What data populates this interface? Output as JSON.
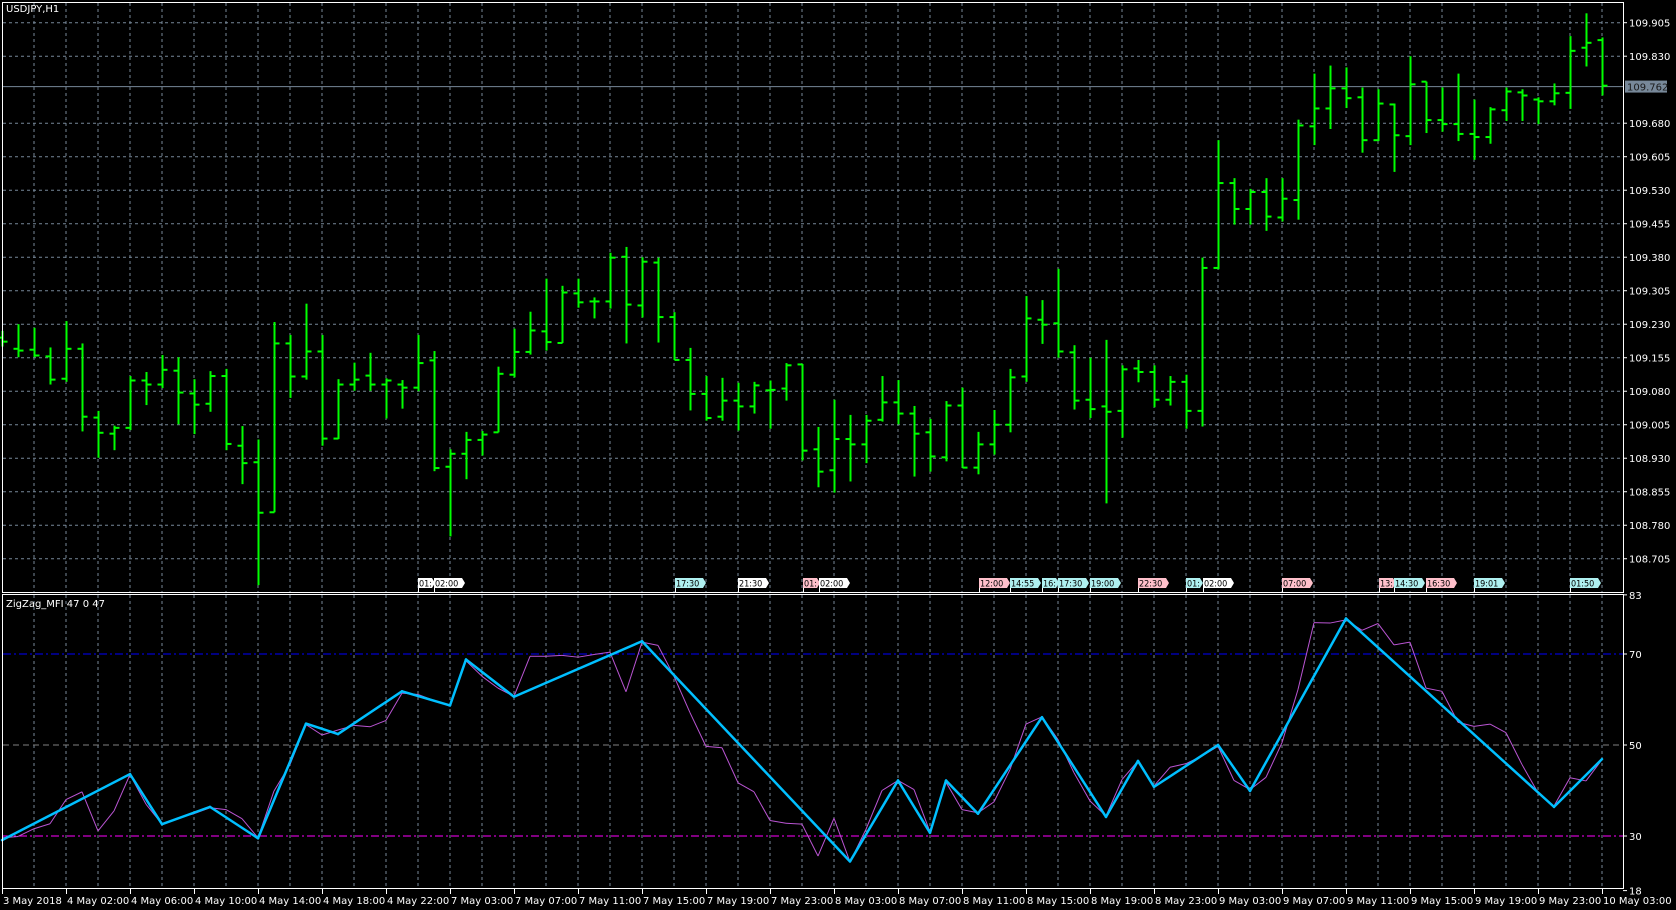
{
  "window": {
    "symbol_title": "USDJPY,H1",
    "indicator_title": "ZigZag_MFI 47 0 47"
  },
  "colors": {
    "background": "#000000",
    "bars": "#00ff00",
    "grid": "#778899",
    "axis": "#ffffff",
    "zigzag": "#00bfff",
    "mfi": "#ba55d3",
    "level_high": "#0000ff",
    "level_mid": "#808080",
    "level_low": "#ff00ff",
    "current_price_badge": "#778899"
  },
  "price_axis": {
    "labels": [
      "109.905",
      "109.830",
      "109.680",
      "109.605",
      "109.530",
      "109.455",
      "109.380",
      "109.305",
      "109.230",
      "109.155",
      "109.080",
      "109.005",
      "108.930",
      "108.855",
      "108.780",
      "108.705"
    ],
    "current_price": "109.762"
  },
  "indicator_axis": {
    "labels": [
      "83",
      "70",
      "50",
      "30",
      "18"
    ],
    "levels": [
      70,
      50,
      30
    ],
    "range": [
      18,
      83
    ]
  },
  "time_axis": {
    "labels": [
      "3 May 2018",
      "4 May 02:00",
      "4 May 06:00",
      "4 May 10:00",
      "4 May 14:00",
      "4 May 18:00",
      "4 May 22:00",
      "7 May 03:00",
      "7 May 07:00",
      "7 May 11:00",
      "7 May 15:00",
      "7 May 19:00",
      "7 May 23:00",
      "8 May 03:00",
      "8 May 07:00",
      "8 May 11:00",
      "8 May 15:00",
      "8 May 19:00",
      "8 May 23:00",
      "9 May 03:00",
      "9 May 07:00",
      "9 May 11:00",
      "9 May 15:00",
      "9 May 19:00",
      "9 May 23:00",
      "10 May 03:00"
    ]
  },
  "events": [
    {
      "label": "01:",
      "type": "neutral"
    },
    {
      "label": "02:00",
      "type": "neutral"
    },
    {
      "label": "17:30",
      "type": "low"
    },
    {
      "label": "21:30",
      "type": "neutral"
    },
    {
      "label": "01:",
      "type": "high"
    },
    {
      "label": "02:00",
      "type": "neutral"
    },
    {
      "label": "12:00",
      "type": "high"
    },
    {
      "label": "14:55",
      "type": "low"
    },
    {
      "label": "16:",
      "type": "low"
    },
    {
      "label": "17:30",
      "type": "low"
    },
    {
      "label": "19:00",
      "type": "low"
    },
    {
      "label": "22:30",
      "type": "high"
    },
    {
      "label": "01:",
      "type": "low"
    },
    {
      "label": "02:00",
      "type": "neutral"
    },
    {
      "label": "07:00",
      "type": "high"
    },
    {
      "label": "13:",
      "type": "high"
    },
    {
      "label": "14:30",
      "type": "low"
    },
    {
      "label": "16:30",
      "type": "high"
    },
    {
      "label": "19:01",
      "type": "low"
    },
    {
      "label": "01:50",
      "type": "low"
    }
  ],
  "chart_data": {
    "type": "ohlc",
    "symbol": "USDJPY",
    "timeframe": "H1",
    "price_range": [
      108.649,
      109.955
    ],
    "ohlc": [
      [
        109.2,
        109.215,
        109.18,
        109.191
      ],
      [
        109.175,
        109.23,
        109.156,
        109.171
      ],
      [
        109.173,
        109.222,
        109.156,
        109.16
      ],
      [
        109.158,
        109.178,
        109.095,
        109.106
      ],
      [
        109.108,
        109.237,
        109.101,
        109.175
      ],
      [
        109.175,
        109.187,
        108.99,
        109.023
      ],
      [
        109.021,
        109.036,
        108.931,
        108.987
      ],
      [
        108.985,
        109.003,
        108.948,
        108.998
      ],
      [
        108.998,
        109.114,
        108.993,
        109.104
      ],
      [
        109.104,
        109.123,
        109.049,
        109.095
      ],
      [
        109.095,
        109.161,
        109.087,
        109.128
      ],
      [
        109.126,
        109.156,
        109.006,
        109.077
      ],
      [
        109.075,
        109.107,
        108.984,
        109.05
      ],
      [
        109.052,
        109.125,
        109.034,
        109.114
      ],
      [
        109.114,
        109.13,
        108.948,
        108.962
      ],
      [
        108.958,
        109.002,
        108.872,
        108.919
      ],
      [
        108.921,
        108.972,
        108.646,
        108.808
      ],
      [
        108.809,
        109.235,
        108.809,
        109.187
      ],
      [
        109.187,
        109.206,
        109.065,
        109.113
      ],
      [
        109.113,
        109.276,
        109.106,
        109.169
      ],
      [
        109.169,
        109.206,
        108.958,
        108.974
      ],
      [
        108.974,
        109.107,
        108.973,
        109.095
      ],
      [
        109.095,
        109.144,
        109.081,
        109.106
      ],
      [
        109.115,
        109.166,
        109.081,
        109.095
      ],
      [
        109.095,
        109.109,
        109.019,
        109.104
      ],
      [
        109.095,
        109.105,
        109.041,
        109.088
      ],
      [
        109.088,
        109.206,
        109.08,
        109.143
      ],
      [
        109.149,
        109.17,
        108.901,
        108.908
      ],
      [
        108.911,
        108.95,
        108.755,
        108.94
      ],
      [
        108.94,
        108.989,
        108.883,
        108.971
      ],
      [
        108.971,
        108.991,
        108.936,
        108.983
      ],
      [
        108.988,
        109.135,
        108.988,
        109.119
      ],
      [
        109.117,
        109.22,
        109.111,
        109.168
      ],
      [
        109.168,
        109.258,
        109.162,
        109.216
      ],
      [
        109.214,
        109.332,
        109.171,
        109.19
      ],
      [
        109.188,
        109.316,
        109.188,
        109.301
      ],
      [
        109.299,
        109.332,
        109.267,
        109.279
      ],
      [
        109.281,
        109.29,
        109.243,
        109.281
      ],
      [
        109.281,
        109.39,
        109.265,
        109.379
      ],
      [
        109.381,
        109.403,
        109.187,
        109.274
      ],
      [
        109.272,
        109.38,
        109.245,
        109.37
      ],
      [
        109.368,
        109.379,
        109.189,
        109.246
      ],
      [
        109.246,
        109.257,
        109.15,
        109.15
      ],
      [
        109.15,
        109.177,
        109.037,
        109.074
      ],
      [
        109.074,
        109.114,
        109.014,
        109.02
      ],
      [
        109.023,
        109.11,
        109.014,
        109.059
      ],
      [
        109.059,
        109.099,
        108.992,
        109.046
      ],
      [
        109.046,
        109.101,
        109.03,
        109.093
      ],
      [
        109.082,
        109.104,
        108.996,
        109.083
      ],
      [
        109.086,
        109.143,
        109.059,
        109.138
      ],
      [
        109.14,
        109.141,
        108.925,
        108.947
      ],
      [
        108.95,
        109.0,
        108.865,
        108.9
      ],
      [
        108.903,
        109.061,
        108.853,
        108.973
      ],
      [
        108.973,
        109.027,
        108.878,
        108.961
      ],
      [
        108.961,
        109.027,
        108.919,
        109.014
      ],
      [
        109.016,
        109.114,
        109.012,
        109.055
      ],
      [
        109.055,
        109.105,
        109.006,
        109.03
      ],
      [
        109.03,
        109.047,
        108.889,
        108.985
      ],
      [
        108.988,
        109.018,
        108.9,
        108.934
      ],
      [
        108.932,
        109.058,
        108.923,
        109.048
      ],
      [
        109.048,
        109.088,
        108.909,
        108.909
      ],
      [
        108.909,
        108.989,
        108.894,
        108.961
      ],
      [
        108.961,
        109.038,
        108.938,
        109.005
      ],
      [
        109.005,
        109.13,
        108.988,
        109.111
      ],
      [
        109.113,
        109.293,
        109.101,
        109.243
      ],
      [
        109.24,
        109.284,
        109.186,
        109.229
      ],
      [
        109.232,
        109.354,
        109.155,
        109.169
      ],
      [
        109.167,
        109.183,
        109.039,
        109.059
      ],
      [
        109.061,
        109.155,
        109.02,
        109.04
      ],
      [
        109.046,
        109.195,
        108.829,
        109.034
      ],
      [
        109.036,
        109.138,
        108.976,
        109.129
      ],
      [
        109.131,
        109.15,
        109.1,
        109.123
      ],
      [
        109.123,
        109.138,
        109.044,
        109.061
      ],
      [
        109.061,
        109.114,
        109.048,
        109.101
      ],
      [
        109.101,
        109.117,
        108.996,
        109.036
      ],
      [
        109.036,
        109.379,
        109.001,
        109.356
      ],
      [
        109.356,
        109.642,
        109.353,
        109.546
      ],
      [
        109.546,
        109.557,
        109.453,
        109.488
      ],
      [
        109.488,
        109.533,
        109.453,
        109.526
      ],
      [
        109.526,
        109.557,
        109.439,
        109.471
      ],
      [
        109.469,
        109.557,
        109.46,
        109.511
      ],
      [
        109.508,
        109.688,
        109.464,
        109.675
      ],
      [
        109.673,
        109.791,
        109.631,
        109.713
      ],
      [
        109.713,
        109.809,
        109.667,
        109.758
      ],
      [
        109.758,
        109.805,
        109.714,
        109.736
      ],
      [
        109.738,
        109.76,
        109.614,
        109.642
      ],
      [
        109.642,
        109.756,
        109.64,
        109.724
      ],
      [
        109.722,
        109.724,
        109.571,
        109.653
      ],
      [
        109.651,
        109.83,
        109.631,
        109.767
      ],
      [
        109.773,
        109.773,
        109.658,
        109.687
      ],
      [
        109.687,
        109.76,
        109.661,
        109.678
      ],
      [
        109.678,
        109.791,
        109.64,
        109.656
      ],
      [
        109.656,
        109.733,
        109.598,
        109.649
      ],
      [
        109.649,
        109.716,
        109.634,
        109.711
      ],
      [
        109.709,
        109.76,
        109.685,
        109.751
      ],
      [
        109.749,
        109.756,
        109.685,
        109.742
      ],
      [
        109.733,
        109.738,
        109.678,
        109.729
      ],
      [
        109.729,
        109.769,
        109.72,
        109.747
      ],
      [
        109.748,
        109.875,
        109.712,
        109.842
      ],
      [
        109.849,
        109.926,
        109.807,
        109.86
      ],
      [
        109.866,
        109.872,
        109.742,
        109.764
      ]
    ],
    "mfi": [
      29.6,
      29.9,
      31.6,
      32.7,
      38.0,
      39.7,
      31.1,
      35.5,
      43.5,
      37.0,
      32.6,
      34.0,
      34.9,
      36.2,
      35.8,
      33.8,
      29.6,
      39.9,
      45.7,
      54.5,
      52.2,
      53.3,
      54.3,
      54.0,
      55.4,
      61.4,
      61.1,
      59.8,
      58.5,
      68.5,
      65.1,
      62.5,
      60.7,
      69.5,
      69.5,
      69.7,
      69.3,
      69.9,
      70.4,
      61.7,
      72.6,
      71.9,
      65.1,
      57.1,
      49.7,
      49.4,
      41.7,
      39.7,
      33.4,
      32.8,
      32.6,
      25.6,
      33.9,
      24.3,
      31.5,
      40.0,
      42.2,
      40.2,
      30.9,
      41.8,
      35.8,
      35.1,
      37.5,
      44.6,
      54.6,
      56.2,
      51.2,
      43.9,
      37.7,
      34.4,
      42.4,
      46.5,
      41.0,
      45.1,
      45.9,
      47.6,
      49.7,
      42.2,
      40.2,
      42.9,
      50.5,
      62.2,
      76.9,
      76.8,
      77.5,
      75.2,
      76.7,
      72.0,
      72.6,
      62.5,
      61.8,
      55.0,
      54.1,
      54.6,
      52.7,
      45.7,
      39.5,
      36.6,
      42.8,
      42.1,
      46.8
    ],
    "zigzag": [
      [
        0,
        29.1
      ],
      [
        8,
        43.6
      ],
      [
        10,
        32.6
      ],
      [
        13,
        36.4
      ],
      [
        16,
        29.5
      ],
      [
        19,
        54.7
      ],
      [
        21,
        52.4
      ],
      [
        25,
        61.8
      ],
      [
        28,
        58.7
      ],
      [
        29,
        68.8
      ],
      [
        32,
        60.6
      ],
      [
        40,
        72.8
      ],
      [
        53,
        24.4
      ],
      [
        56,
        42.2
      ],
      [
        58,
        30.7
      ],
      [
        59,
        42.2
      ],
      [
        61,
        34.9
      ],
      [
        65,
        56.1
      ],
      [
        69,
        34.2
      ],
      [
        71,
        46.5
      ],
      [
        72,
        40.8
      ],
      [
        76,
        50.0
      ],
      [
        78,
        39.9
      ],
      [
        84,
        77.8
      ],
      [
        97,
        36.4
      ],
      [
        100,
        46.9
      ]
    ]
  }
}
